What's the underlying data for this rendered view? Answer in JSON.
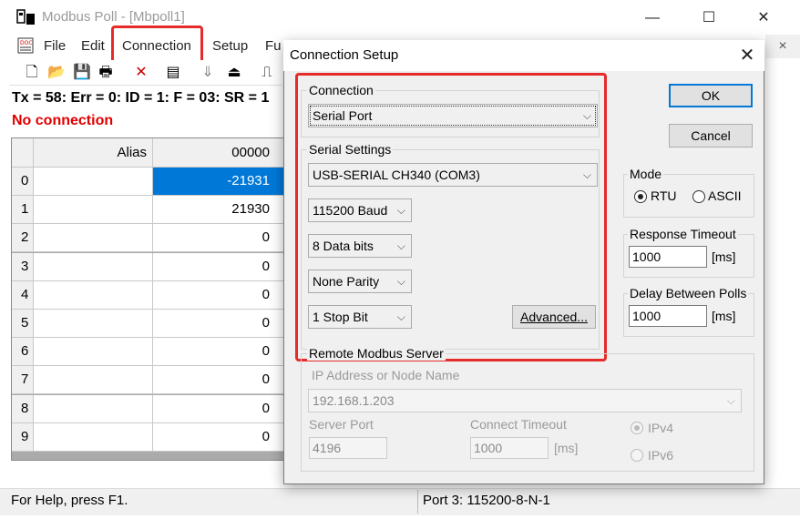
{
  "main": {
    "title": "Modbus Poll - [Mbpoll1]",
    "window_buttons": {
      "minimize": "—",
      "maximize": "☐",
      "close": "✕"
    },
    "menu": [
      "File",
      "Edit",
      "Connection",
      "Setup",
      "Fu"
    ],
    "mdi_close": "×",
    "stats": "Tx = 58: Err = 0: ID = 1: F = 03: SR = 1",
    "status_message": "No connection",
    "grid": {
      "header_alias": "Alias",
      "header_col": "00000",
      "rows": [
        {
          "n": "0",
          "v": "-21931"
        },
        {
          "n": "1",
          "v": "21930"
        },
        {
          "n": "2",
          "v": "0"
        },
        {
          "n": "3",
          "v": "0"
        },
        {
          "n": "4",
          "v": "0"
        },
        {
          "n": "5",
          "v": "0"
        },
        {
          "n": "6",
          "v": "0"
        },
        {
          "n": "7",
          "v": "0"
        },
        {
          "n": "8",
          "v": "0"
        },
        {
          "n": "9",
          "v": "0"
        }
      ]
    },
    "statusbar": {
      "left": "For Help, press F1.",
      "right": "Port 3: 115200-8-N-1"
    }
  },
  "dialog": {
    "title": "Connection Setup",
    "close": "✕",
    "connection_label": "Connection",
    "connection_value": "Serial Port",
    "serial_label": "Serial Settings",
    "port_value": "USB-SERIAL CH340 (COM3)",
    "baud_value": "115200 Baud",
    "databits_value": "8 Data bits",
    "parity_value": "None Parity",
    "stopbit_value": "1 Stop Bit",
    "advanced_label": "Advanced...",
    "ok_label": "OK",
    "cancel_label": "Cancel",
    "mode_label": "Mode",
    "mode_rtu": "RTU",
    "mode_ascii": "ASCII",
    "response_timeout_label": "Response Timeout",
    "response_timeout_value": "1000",
    "delay_label": "Delay Between Polls",
    "delay_value": "1000",
    "unit_ms": "[ms]",
    "remote_label": "Remote Modbus Server",
    "ip_label": "IP Address or Node Name",
    "ip_value": "192.168.1.203",
    "server_port_label": "Server Port",
    "server_port_value": "4196",
    "connect_timeout_label": "Connect Timeout",
    "connect_timeout_value": "1000",
    "ipv4": "IPv4",
    "ipv6": "IPv6"
  },
  "colors": {
    "highlight_box": "#e52b2b",
    "selection": "#0078d7",
    "error_text": "#e00000"
  }
}
